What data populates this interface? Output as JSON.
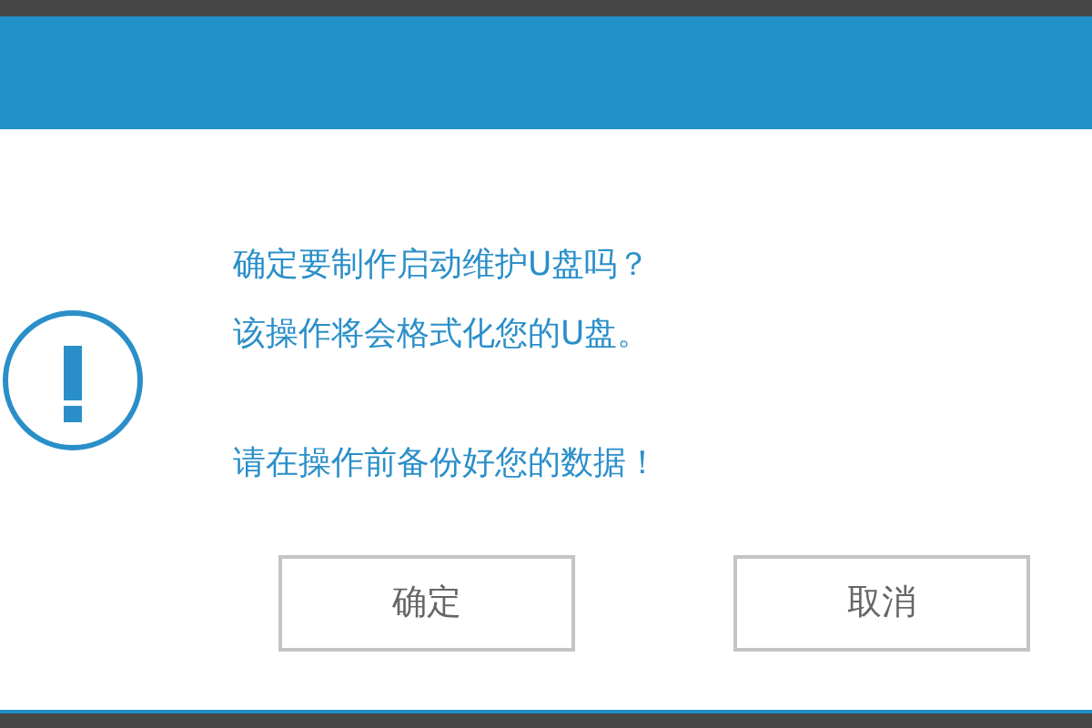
{
  "dialog": {
    "message": [
      "确定要制作启动维护U盘吗？",
      "该操作将会格式化您的U盘。"
    ],
    "note": "请在操作前备份好您的数据！",
    "buttons": [
      "确定",
      "取消"
    ]
  }
}
